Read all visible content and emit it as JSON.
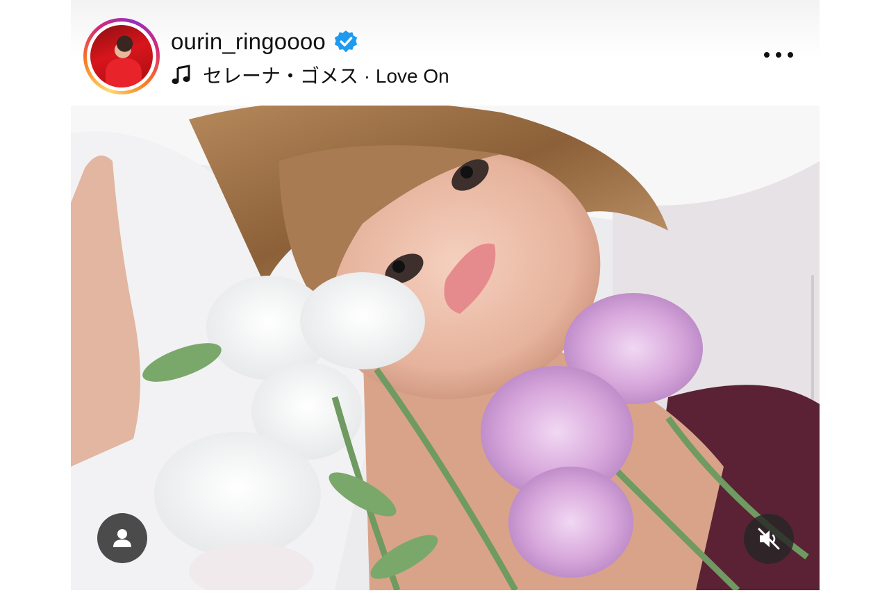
{
  "post": {
    "username": "ourin_ringoooo",
    "verified": true,
    "music": "セレーナ・ゴメス · Love On",
    "avatar_alt": "ourin_ringoooo profile photo"
  },
  "icons": {
    "verified": "verified-badge-icon",
    "music": "music-note-icon",
    "more": "more-options-icon",
    "tag": "person-tag-icon",
    "mute": "speaker-muted-icon"
  },
  "colors": {
    "verified_blue": "#1d9bf0",
    "overlay_button": "#262626",
    "text": "#111111"
  }
}
